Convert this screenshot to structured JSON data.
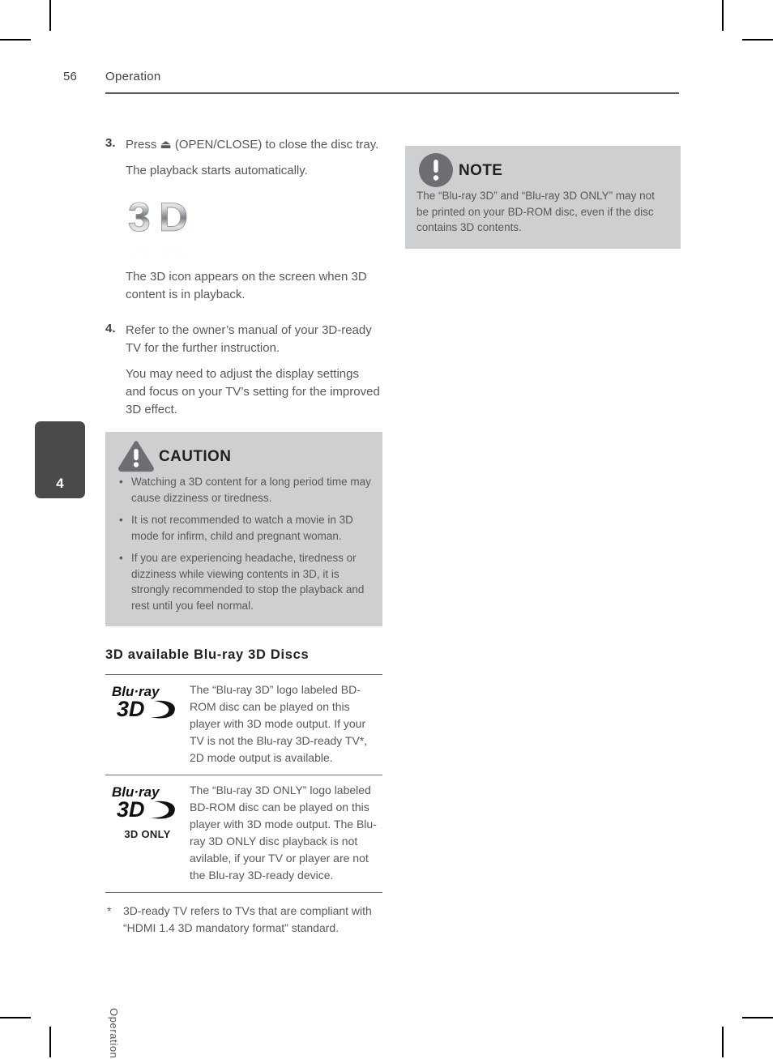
{
  "header": {
    "page_number": "56",
    "title": "Operation"
  },
  "sidebar": {
    "chapter_number": "4",
    "chapter_label": "Operation"
  },
  "steps": [
    {
      "number": "3.",
      "lines": [
        "Press ⏏ (OPEN/CLOSE) to close the disc tray.",
        "The playback starts automatically."
      ]
    },
    {
      "number": "4.",
      "lines": [
        "Refer to the owner’s manual of your 3D-ready TV for the further instruction.",
        "You may need to adjust the display settings and focus on your TV’s setting for the improved 3D effect."
      ]
    }
  ],
  "icon_caption": "The 3D icon appears on the screen when 3D content is in playback.",
  "icon_3d_text": "3D",
  "caution": {
    "title": "CAUTION",
    "icon": "warning-triangle-icon",
    "bullets": [
      "Watching a 3D content for a long period time may cause dizziness or tiredness.",
      "It is not recommended to watch a movie in 3D mode for infirm, child and pregnant woman.",
      "If you are experiencing headache, tiredness or dizziness while viewing contents in 3D, it is strongly recommended to stop the playback and rest until you feel normal."
    ],
    "bullet_char": "•"
  },
  "note": {
    "title": "NOTE",
    "icon": "exclamation-circle-icon",
    "text": "The “Blu-ray 3D” and “Blu-ray 3D ONLY” may not be printed on your BD-ROM disc, even if the disc contains 3D contents."
  },
  "section": {
    "heading": "3D available Blu-ray 3D Discs"
  },
  "disc_table": {
    "rows": [
      {
        "logo_top": "Blu·ray",
        "logo_bottom": "3D",
        "logo_sub": "",
        "description": "The “Blu-ray 3D” logo labeled BD-ROM disc can be played on this player with 3D mode output. If your TV is not the Blu-ray 3D-ready TV*, 2D mode output is available."
      },
      {
        "logo_top": "Blu·ray",
        "logo_bottom": "3D",
        "logo_sub": "3D ONLY",
        "description": "The “Blu-ray 3D ONLY” logo labeled BD-ROM disc can be played on this player with 3D mode output. The Blu-ray 3D ONLY disc playback is not avilable, if your TV or player are not the Blu-ray 3D-ready device."
      }
    ]
  },
  "footnote": {
    "mark": "*",
    "text": "3D-ready TV refers to TVs that are compliant with “HDMI 1.4 3D mandatory format” standard."
  },
  "colors": {
    "box_background": "#cecfd0",
    "tab_background": "#4a4a4a",
    "body_text": "#58585a",
    "heading_text": "#231f20"
  }
}
